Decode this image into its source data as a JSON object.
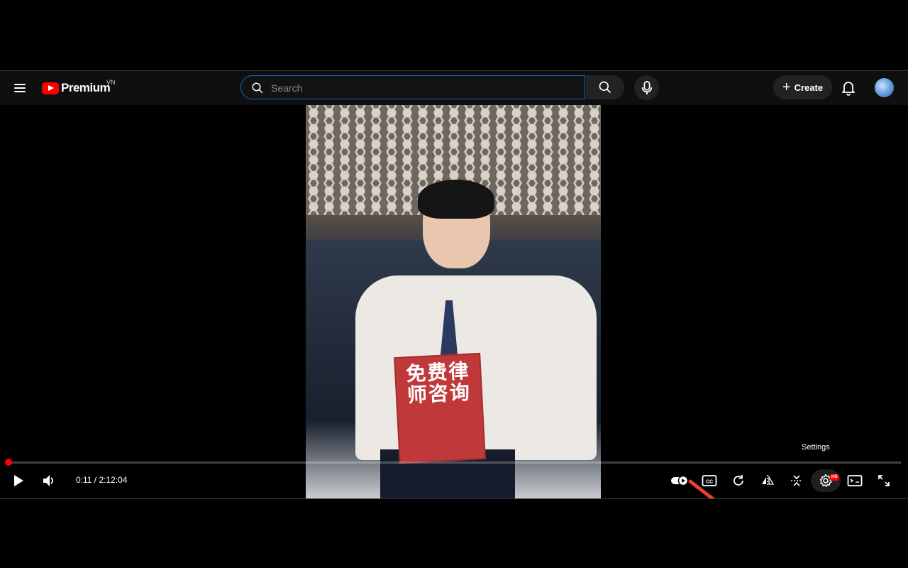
{
  "header": {
    "logo_text": "Premium",
    "country_code": "VN",
    "search_placeholder": "Search",
    "create_label": "Create"
  },
  "video": {
    "sign_text": "免费律师咨询"
  },
  "player": {
    "time_display": "0:11 / 2:12:04",
    "progress_fraction": 0.0014,
    "tooltip": "Settings",
    "quality_badge": "HD",
    "autoplay_on": true
  },
  "colors": {
    "accent": "#ff0000",
    "search_border": "#1c62b9",
    "annotation_arrow": "#e8412c"
  },
  "icons": [
    "menu-icon",
    "search-icon",
    "mic-icon",
    "plus-icon",
    "bell-icon",
    "play-icon",
    "volume-icon",
    "autoplay-toggle-icon",
    "captions-icon",
    "loop-icon",
    "mirror-icon",
    "fullscreen-exit-icon",
    "settings-icon",
    "miniplayer-icon",
    "fullscreen-icon"
  ]
}
